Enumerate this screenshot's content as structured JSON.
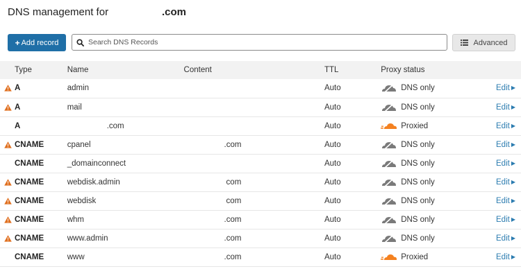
{
  "header": {
    "title": "DNS management for",
    "domain": ".com"
  },
  "toolbar": {
    "add_label": "Add record",
    "add_plus": "+",
    "search_placeholder": "Search DNS Records",
    "advanced_label": "Advanced"
  },
  "table": {
    "columns": {
      "type": "Type",
      "name": "Name",
      "content": "Content",
      "ttl": "TTL",
      "proxy": "Proxy status"
    },
    "rows": [
      {
        "warn": true,
        "type": "A",
        "name": "admin",
        "content": "",
        "ttl": "Auto",
        "proxied": false,
        "proxy": "DNS only",
        "edit": "Edit"
      },
      {
        "warn": true,
        "type": "A",
        "name": "mail",
        "content": "",
        "ttl": "Auto",
        "proxied": false,
        "proxy": "DNS only",
        "edit": "Edit"
      },
      {
        "warn": false,
        "type": "A",
        "name": ".com",
        "content": "",
        "ttl": "Auto",
        "proxied": true,
        "proxy": "Proxied",
        "edit": "Edit"
      },
      {
        "warn": true,
        "type": "CNAME",
        "name": "cpanel",
        "content": ".com",
        "ttl": "Auto",
        "proxied": false,
        "proxy": "DNS only",
        "edit": "Edit"
      },
      {
        "warn": false,
        "type": "CNAME",
        "name": "_domainconnect",
        "content": "",
        "ttl": "Auto",
        "proxied": false,
        "proxy": "DNS only",
        "edit": "Edit"
      },
      {
        "warn": true,
        "type": "CNAME",
        "name": "webdisk.admin",
        "content": "com",
        "ttl": "Auto",
        "proxied": false,
        "proxy": "DNS only",
        "edit": "Edit"
      },
      {
        "warn": true,
        "type": "CNAME",
        "name": "webdisk",
        "content": "com",
        "ttl": "Auto",
        "proxied": false,
        "proxy": "DNS only",
        "edit": "Edit"
      },
      {
        "warn": true,
        "type": "CNAME",
        "name": "whm",
        "content": ".com",
        "ttl": "Auto",
        "proxied": false,
        "proxy": "DNS only",
        "edit": "Edit"
      },
      {
        "warn": true,
        "type": "CNAME",
        "name": "www.admin",
        "content": ".com",
        "ttl": "Auto",
        "proxied": false,
        "proxy": "DNS only",
        "edit": "Edit"
      },
      {
        "warn": false,
        "type": "CNAME",
        "name": "www",
        "content": ".com",
        "ttl": "Auto",
        "proxied": true,
        "proxy": "Proxied",
        "edit": "Edit"
      }
    ]
  },
  "icons": {
    "warning": "warning-icon",
    "cloud_grey": "cloud-dns-only-icon",
    "cloud_orange": "cloud-proxied-icon",
    "search": "search-icon",
    "filter": "filter-list-icon"
  },
  "colors": {
    "accent": "#1f6fa7",
    "warning": "#e07020",
    "proxied": "#f48120",
    "dns_only": "#7a7a7a",
    "link": "#2c7cb0"
  }
}
